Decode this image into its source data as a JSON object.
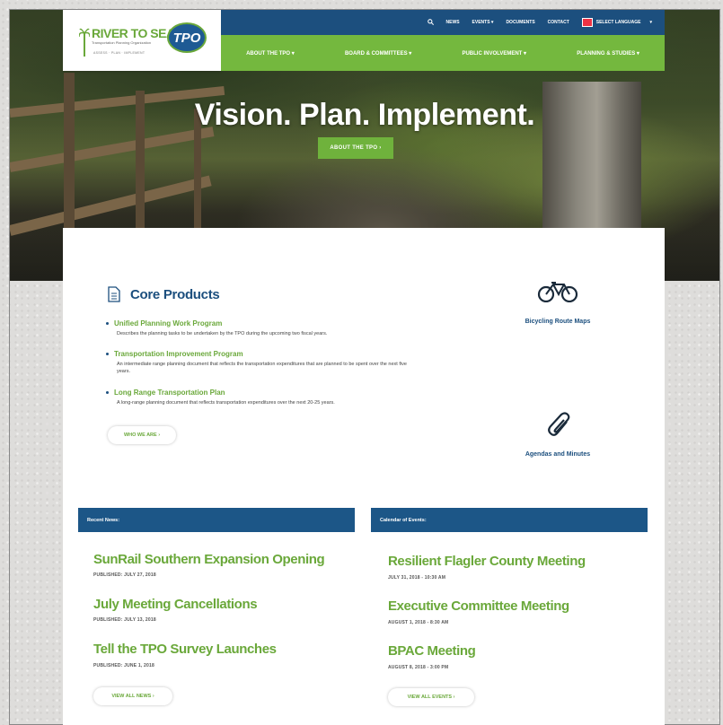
{
  "header": {
    "logo": {
      "name": "RIVER TO SEA",
      "tpo": "TPO",
      "tagline": "Transportation Planning Organization",
      "subline": "ASSESS · PLAN · IMPLEMENT"
    },
    "topbar": {
      "news": "NEWS",
      "events": "EVENTS ▾",
      "documents": "DOCUMENTS",
      "contact": "CONTACT",
      "language": "SELECT LANGUAGE",
      "language_caret": "▾"
    },
    "nav": [
      {
        "label": "ABOUT THE TPO ▾"
      },
      {
        "label": "BOARD & COMMITTEES ▾"
      },
      {
        "label": "PUBLIC INVOLVEMENT ▾"
      },
      {
        "label": "PLANNING & STUDIES ▾"
      }
    ]
  },
  "hero": {
    "title": "Vision. Plan. Implement.",
    "button": "ABOUT THE TPO ›"
  },
  "core": {
    "title": "Core Products",
    "items": [
      {
        "title": "Unified Planning Work Program",
        "desc": "Describes the planning tasks to be undertaken by the TPO during the upcoming two fiscal years."
      },
      {
        "title": "Transportation Improvement Program",
        "desc": "An intermediate range planning document that reflects the transportation expenditures that are planned to be spent over the next five years."
      },
      {
        "title": "Long Range Transportation Plan",
        "desc": "A long-range planning document that reflects transportation expenditures over the next 20-25 years."
      }
    ],
    "who_button": "WHO WE ARE ›"
  },
  "side_links": {
    "bike": "Bicycling Route Maps",
    "agendas": "Agendas and Minutes"
  },
  "news": {
    "heading": "Recent News:",
    "items": [
      {
        "title": "SunRail Southern Expansion Opening",
        "meta": "PUBLISHED: JULY 27, 2018"
      },
      {
        "title": "July Meeting Cancellations",
        "meta": "PUBLISHED: JULY 13, 2018"
      },
      {
        "title": "Tell the TPO Survey Launches",
        "meta": "PUBLISHED: JUNE 1, 2018"
      }
    ],
    "view_all": "VIEW ALL NEWS ›"
  },
  "events": {
    "heading": "Calendar of Events:",
    "items": [
      {
        "title": "Resilient Flagler County Meeting",
        "meta": "JULY 31, 2018 - 10:30 AM"
      },
      {
        "title": "Executive Committee Meeting",
        "meta": "AUGUST 1, 2018 - 8:30 AM"
      },
      {
        "title": "BPAC Meeting",
        "meta": "AUGUST 8, 2018 - 3:00 PM"
      }
    ],
    "view_all": "VIEW ALL EVENTS ›"
  },
  "colors": {
    "blue": "#1c4f7e",
    "green": "#74b83e"
  }
}
